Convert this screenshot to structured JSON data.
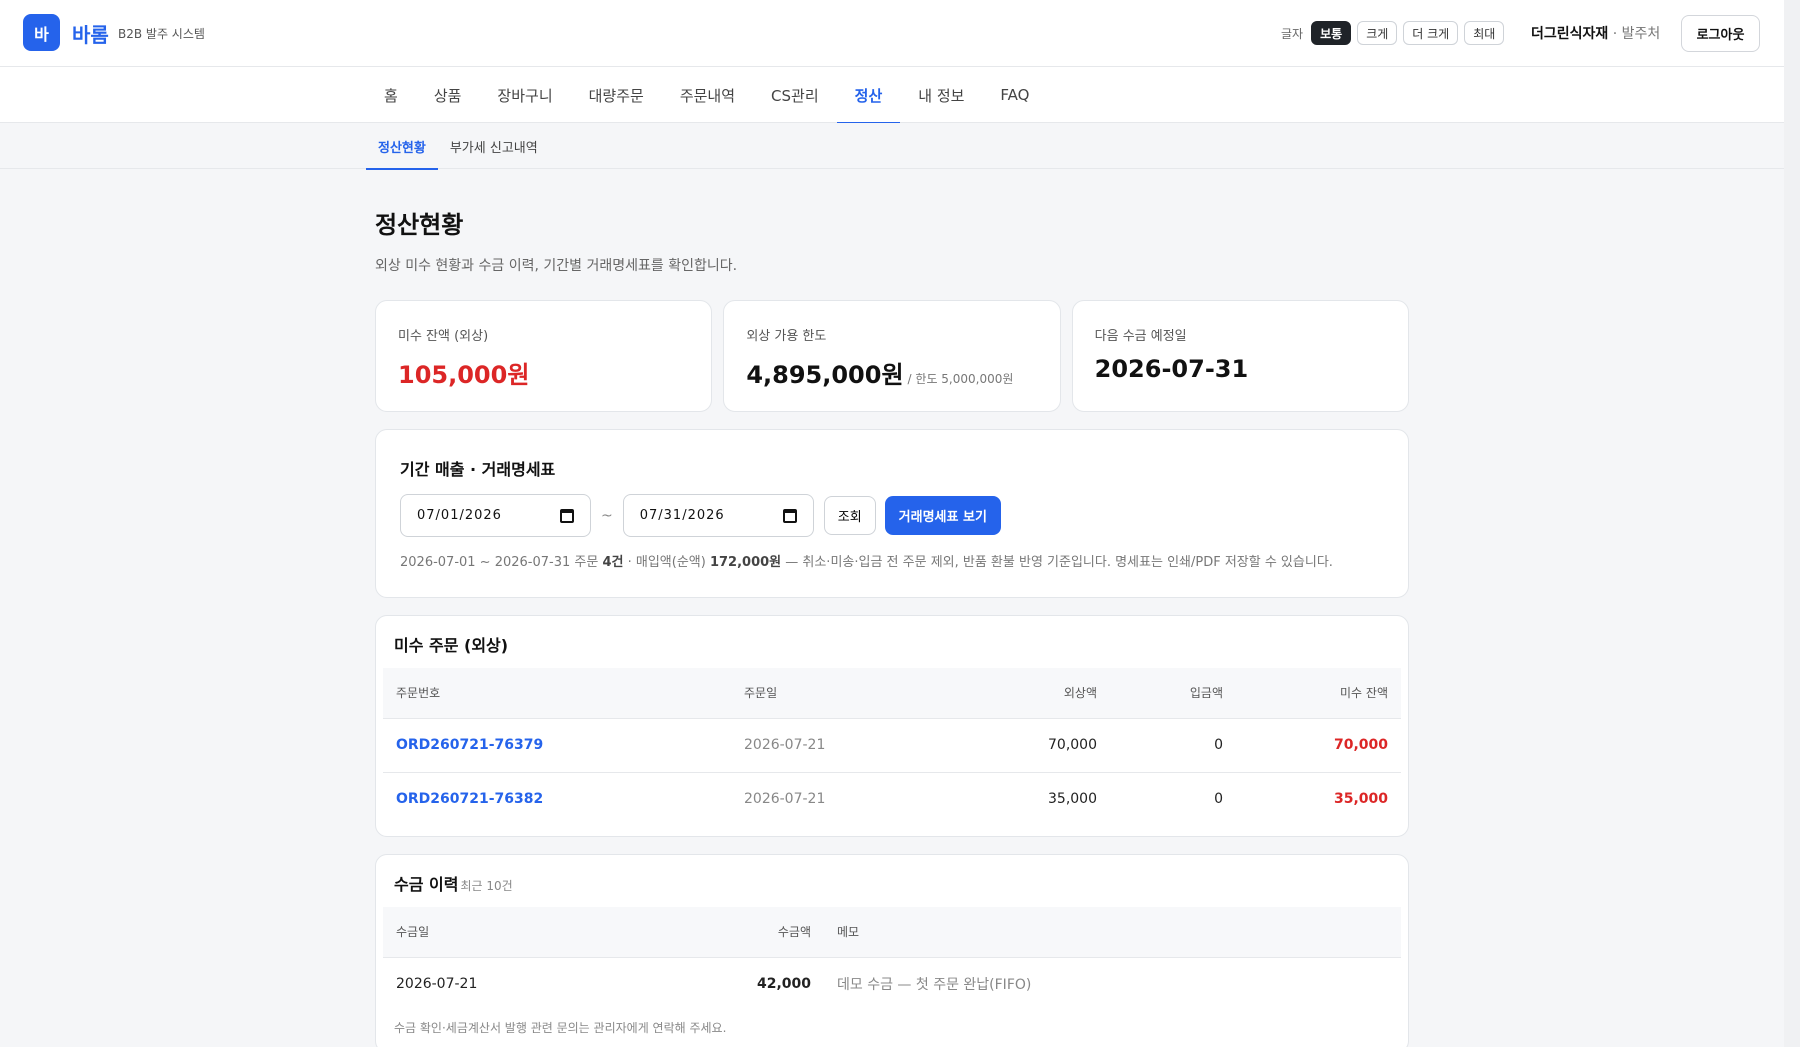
{
  "header": {
    "logo_char": "바",
    "brand": "바롬",
    "brand_sub": "B2B 발주 시스템",
    "font_size_label": "글자",
    "font_sizes": [
      "보통",
      "크게",
      "더 크게",
      "최대"
    ],
    "company_name": "더그린식자재",
    "company_role": " · 발주처",
    "logout_label": "로그아웃"
  },
  "nav": {
    "items": [
      "홈",
      "상품",
      "장바구니",
      "대량주문",
      "주문내역",
      "CS관리",
      "정산",
      "내 정보",
      "FAQ"
    ],
    "active": "정산"
  },
  "subnav": {
    "items": [
      "정산현황",
      "부가세 신고내역"
    ],
    "active": "정산현황"
  },
  "page": {
    "title": "정산현황",
    "description": "외상 미수 현황과 수금 이력, 기간별 거래명세표를 확인합니다."
  },
  "stats": {
    "balance": {
      "label": "미수 잔액 (외상)",
      "value": "105,000원"
    },
    "limit": {
      "label": "외상 가용 한도",
      "value": "4,895,000원",
      "sub": "/ 한도 5,000,000원"
    },
    "next_date": {
      "label": "다음 수금 예정일",
      "value": "2026-07-31"
    }
  },
  "period": {
    "title": "기간 매출 · 거래명세표",
    "start": "07/01/2026",
    "tilde": "~",
    "end": "07/31/2026",
    "query_label": "조회",
    "statement_label": "거래명세표 보기",
    "summary_pre": "2026-07-01 ~ 2026-07-31 주문 ",
    "summary_count": "4건",
    "summary_mid": " · 매입액(순액) ",
    "summary_amount": "172,000원",
    "summary_post": " — 취소·미송·입금 전 주문 제외, 반품 환불 반영 기준입니다. 명세표는 인쇄/PDF 저장할 수 있습니다."
  },
  "unpaid": {
    "title": "미수 주문 (외상)",
    "headers": [
      "주문번호",
      "주문일",
      "외상액",
      "입금액",
      "미수 잔액"
    ],
    "rows": [
      [
        "ORD260721-76379",
        "2026-07-21",
        "70,000",
        "0",
        "70,000"
      ],
      [
        "ORD260721-76382",
        "2026-07-21",
        "35,000",
        "0",
        "35,000"
      ]
    ]
  },
  "collections": {
    "title": "수금 이력",
    "note": "최근 10건",
    "headers": [
      "수금일",
      "수금액",
      "메모"
    ],
    "rows": [
      [
        "2026-07-21",
        "42,000",
        "데모 수금 — 첫 주문 완납(FIFO)"
      ]
    ],
    "footnote": "수금 확인·세금계산서 발행 관련 문의는 관리자에게 연락해 주세요."
  }
}
